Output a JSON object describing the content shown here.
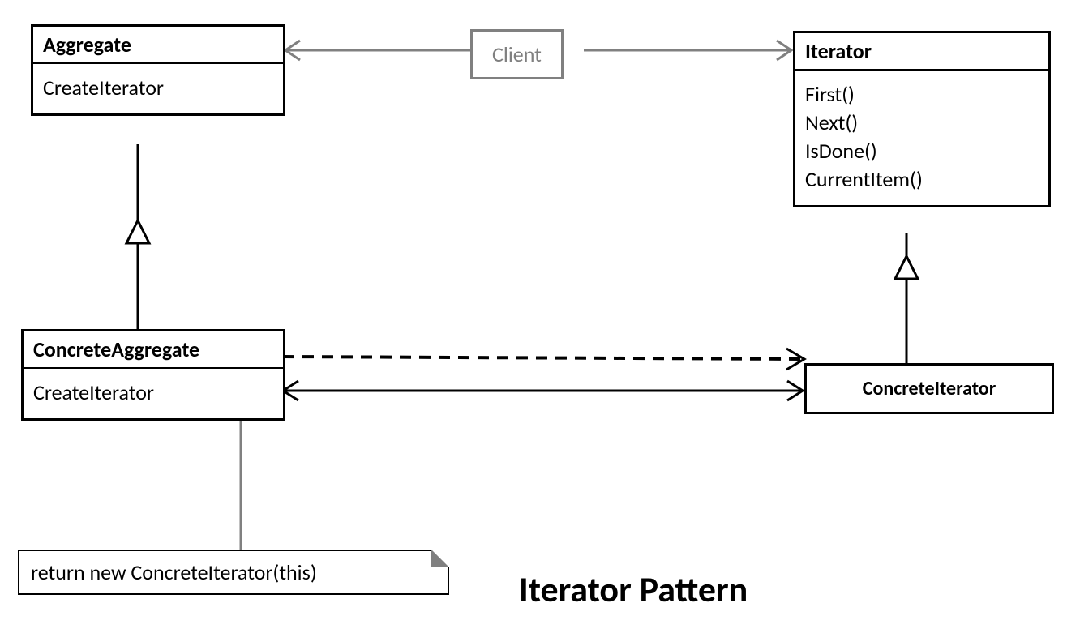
{
  "title": "Iterator Pattern",
  "client": {
    "label": "Client"
  },
  "aggregate": {
    "name": "Aggregate",
    "methods": [
      "CreateIterator"
    ]
  },
  "iterator": {
    "name": "Iterator",
    "methods": [
      "First()",
      "Next()",
      "IsDone()",
      "CurrentItem()"
    ]
  },
  "concreteAggregate": {
    "name": "ConcreteAggregate",
    "methods": [
      "CreateIterator"
    ]
  },
  "concreteIterator": {
    "name": "ConcreteIterator"
  },
  "note": {
    "text": "return new ConcreteIterator(this)"
  }
}
